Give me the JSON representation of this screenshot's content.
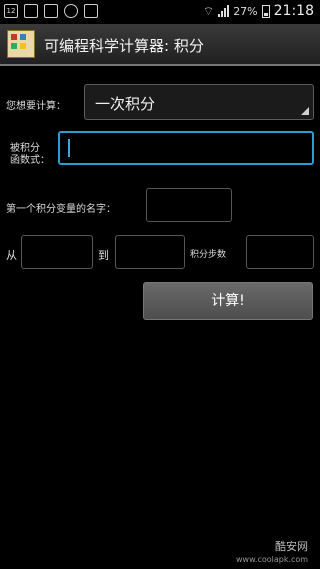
{
  "statusbar": {
    "left_icons": [
      "sim-icon",
      "image-icon",
      "notification-icon",
      "usb-icon",
      "message-icon"
    ],
    "sim_text": "12",
    "battery_percent": "27%",
    "time": "21:18"
  },
  "titlebar": {
    "title": "可编程科学计算器: 积分"
  },
  "form": {
    "calc_label": "您想要计算：",
    "calc_selected": "一次积分",
    "expr_label_1": "被积分",
    "expr_label_2": "函数式：",
    "expr_value": "",
    "var_label": "第一个积分变量的名字：",
    "var_value": "",
    "from_label": "从",
    "from_value": "",
    "to_label": "到",
    "to_value": "",
    "steps_label": "积分步数",
    "steps_value": ""
  },
  "actions": {
    "compute_label": "计算!"
  },
  "watermark": {
    "logo": "酷安网",
    "url": "www.coolapk.com"
  }
}
